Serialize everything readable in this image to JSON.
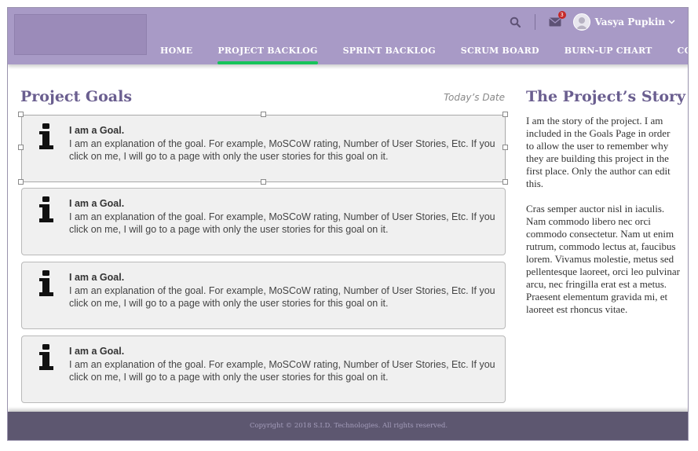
{
  "header": {
    "notifications_count": "3",
    "username": "Vasya Pupkin",
    "icons": {
      "search": "search-icon",
      "mail": "mail-icon",
      "dropdown": "chevron-down-icon"
    }
  },
  "nav": {
    "items": [
      {
        "label": "HOME",
        "active": false
      },
      {
        "label": "PROJECT BACKLOG",
        "active": true
      },
      {
        "label": "SPRINT BACKLOG",
        "active": false
      },
      {
        "label": "SCRUM BOARD",
        "active": false
      },
      {
        "label": "BURN-UP CHART",
        "active": false
      },
      {
        "label": "CONTACT US",
        "active": false
      }
    ]
  },
  "main": {
    "title": "Project Goals",
    "date_label": "Today’s Date",
    "goals": [
      {
        "title": "I am a Goal.",
        "text": "I am an explanation of the goal. For example, MoSCoW rating, Number of User Stories, Etc. If you click on me, I will go to a page with only the user stories for this goal on it."
      },
      {
        "title": "I am a Goal.",
        "text": "I am an explanation of the goal. For example, MoSCoW rating, Number of User Stories, Etc. If you click on me, I will go to a page with only the user stories for this goal on it."
      },
      {
        "title": "I am a Goal.",
        "text": "I am an explanation of the goal. For example, MoSCoW rating, Number of User Stories, Etc. If you click on me, I will go to a page with only the user stories for this goal on it."
      },
      {
        "title": "I am a Goal.",
        "text": "I am an explanation of the goal. For example, MoSCoW rating, Number of User Stories, Etc. If you click on me, I will go to a page with only the user stories for this goal on it."
      }
    ]
  },
  "story": {
    "title": "The Project’s Story",
    "paragraph1": "I am the story of the project. I am included in the Goals Page in order to allow the user to remember why they are building this project in the first place. Only the author can edit this.",
    "paragraph2": "Cras semper auctor nisl in iaculis. Nam commodo libero nec orci commodo consectetur. Nam ut enim rutrum, commodo lectus at, faucibus lorem. Vivamus molestie, metus sed pellentesque laoreet, orci leo pulvinar arcu, nec fringilla erat est a metus. Praesent elementum gravida mi, et laoreet est rhoncus vitae."
  },
  "footer": {
    "copyright": "Copyright © 2018 S.I.D. Technologies. All rights reserved."
  },
  "colors": {
    "header_bg": "#a89ac6",
    "active_underline": "#17c35a",
    "title_color": "#6a5e8f",
    "footer_bg": "#5d5770"
  }
}
